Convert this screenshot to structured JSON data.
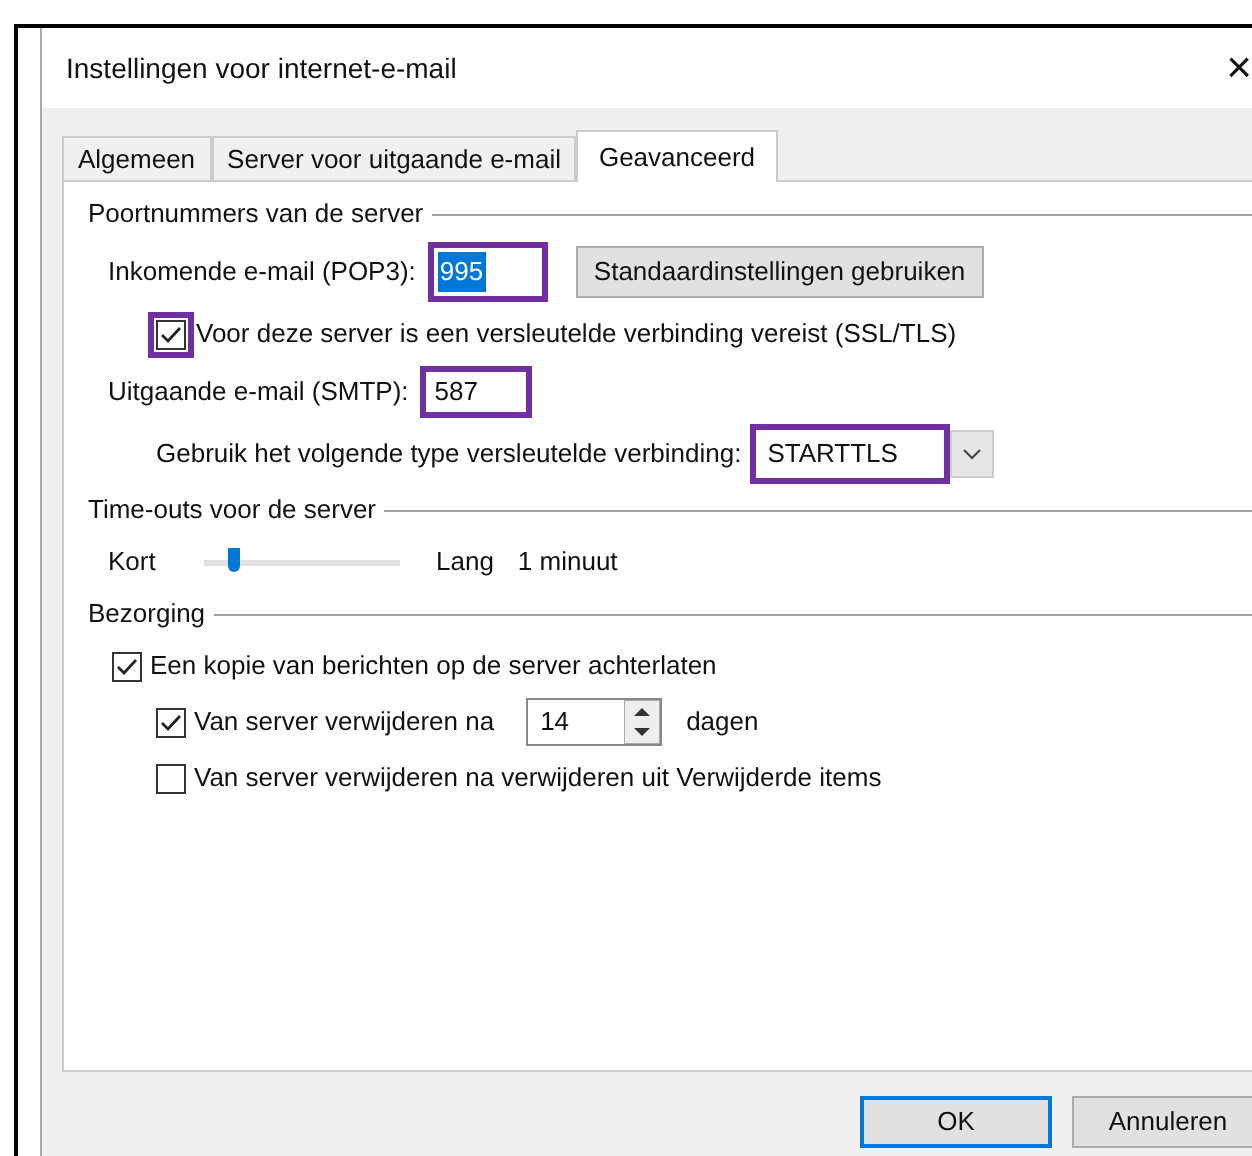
{
  "window": {
    "title": "Instellingen voor internet-e-mail",
    "close": "×"
  },
  "tabs": [
    {
      "label": "Algemeen",
      "selected": false
    },
    {
      "label": "Server voor uitgaande e-mail",
      "selected": false
    },
    {
      "label": "Geavanceerd",
      "selected": true
    }
  ],
  "ports": {
    "title": "Poortnummers van de server",
    "incoming": {
      "label": "Inkomende e-mail (POP3):",
      "value": "995",
      "highlighted": true,
      "marked": true
    },
    "defaults_button": "Standaardinstellingen gebruiken",
    "ssl": {
      "label": "Voor deze server is een versleutelde verbinding vereist (SSL/TLS)",
      "checked": true,
      "marked": true
    },
    "outgoing": {
      "label": "Uitgaande e-mail (SMTP):",
      "value": "587",
      "highlighted": false,
      "marked": true
    },
    "encryption": {
      "label": "Gebruik het volgende type versleutelde verbinding:",
      "value": "STARTTLS",
      "marked": true
    }
  },
  "timeouts": {
    "title": "Time-outs voor de server",
    "min_label": "Kort",
    "max_label": "Lang",
    "level": 0.15,
    "reading": "1 minuut"
  },
  "delivery": {
    "title": "Bezorging",
    "options": [
      {
        "kind": "checkbox",
        "label": "Een kopie van berichten op de server achterlaten",
        "checked": true,
        "indented": false
      },
      {
        "kind": "spin",
        "label": "Van server verwijderen na",
        "checked": true,
        "indented": true,
        "value": "14",
        "unit": "dagen"
      },
      {
        "kind": "checkbox",
        "label": "Van server verwijderen na verwijderen uit Verwijderde items",
        "checked": false,
        "indented": true
      }
    ]
  },
  "buttons": [
    {
      "label": "OK",
      "default": true
    },
    {
      "label": "Annuleren",
      "default": false
    }
  ]
}
